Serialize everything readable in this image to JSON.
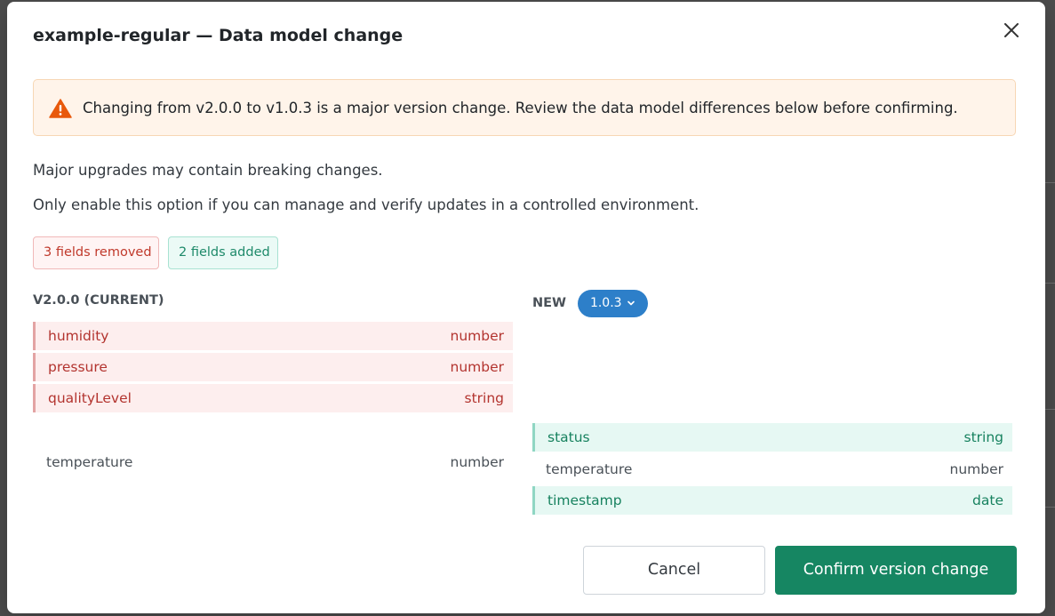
{
  "modal": {
    "title": "example-regular — Data model change",
    "close_icon": "close-icon",
    "alert": {
      "icon": "warning-triangle-icon",
      "text": "Changing from v2.0.0 to v1.0.3 is a major version change. Review the data model differences below before confirming."
    },
    "paragraphs": [
      "Major upgrades may contain breaking changes.",
      "Only enable this option if you can manage and verify updates in a controlled environment."
    ],
    "badges": {
      "removed": "3 fields removed",
      "added": "2 fields added"
    },
    "current": {
      "heading": "V2.0.0 (CURRENT)",
      "fields": [
        {
          "name": "humidity",
          "type": "number",
          "status": "removed"
        },
        {
          "name": "pressure",
          "type": "number",
          "status": "removed"
        },
        {
          "name": "qualityLevel",
          "type": "string",
          "status": "removed"
        },
        {
          "name": "temperature",
          "type": "number",
          "status": "unchanged"
        }
      ]
    },
    "new": {
      "heading": "NEW",
      "version": "1.0.3",
      "version_icon": "chevron-down-icon",
      "fields": [
        {
          "name": "status",
          "type": "string",
          "status": "added"
        },
        {
          "name": "temperature",
          "type": "number",
          "status": "unchanged"
        },
        {
          "name": "timestamp",
          "type": "date",
          "status": "added"
        }
      ]
    },
    "buttons": {
      "cancel": "Cancel",
      "confirm": "Confirm version change"
    }
  },
  "colors": {
    "removed_text": "#b3342f",
    "removed_bg": "#fdeeee",
    "added_text": "#17825f",
    "added_bg": "#e6f8f3",
    "warning_icon": "#e8590c",
    "version_pill": "#2d7fc9",
    "confirm_button": "#168662"
  }
}
